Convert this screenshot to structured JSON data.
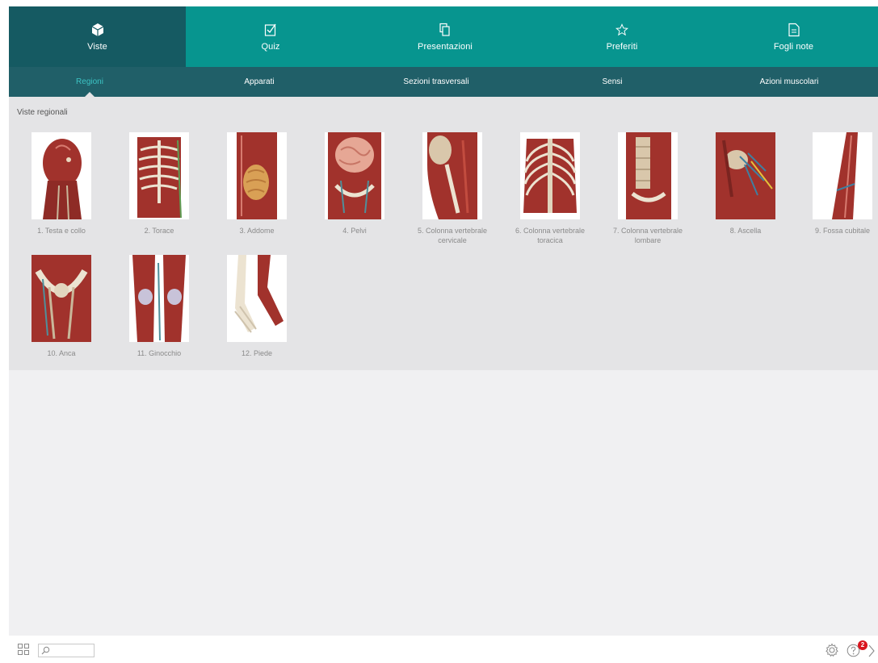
{
  "topnav": {
    "tabs": [
      {
        "label": "Viste",
        "icon": "cube-icon",
        "active": true
      },
      {
        "label": "Quiz",
        "icon": "checkbox-icon",
        "active": false
      },
      {
        "label": "Presentazioni",
        "icon": "slides-icon",
        "active": false
      },
      {
        "label": "Preferiti",
        "icon": "star-icon",
        "active": false
      },
      {
        "label": "Fogli note",
        "icon": "note-icon",
        "active": false
      }
    ]
  },
  "subnav": {
    "tabs": [
      {
        "label": "Regioni",
        "active": true
      },
      {
        "label": "Apparati",
        "active": false
      },
      {
        "label": "Sezioni trasversali",
        "active": false
      },
      {
        "label": "Sensi",
        "active": false
      },
      {
        "label": "Azioni muscolari",
        "active": false
      }
    ]
  },
  "main": {
    "section_title": "Viste regionali",
    "items": [
      {
        "caption": "1. Testa e collo"
      },
      {
        "caption": "2. Torace"
      },
      {
        "caption": "3. Addome"
      },
      {
        "caption": "4. Pelvi"
      },
      {
        "caption": "5. Colonna vertebrale cervicale"
      },
      {
        "caption": "6. Colonna vertebrale toracica"
      },
      {
        "caption": "7. Colonna vertebrale lombare"
      },
      {
        "caption": "8. Ascella"
      },
      {
        "caption": "9. Fossa cubitale"
      },
      {
        "caption": "10. Anca"
      },
      {
        "caption": "11. Ginocchio"
      },
      {
        "caption": "12. Piede"
      }
    ]
  },
  "bottombar": {
    "search_value": "",
    "notification_count": "2"
  },
  "colors": {
    "nav_teal": "#07958f",
    "nav_active": "#155a62",
    "subnav": "#205f68",
    "subnav_active_text": "#3cc3c4",
    "muscle": "#a1322c"
  }
}
